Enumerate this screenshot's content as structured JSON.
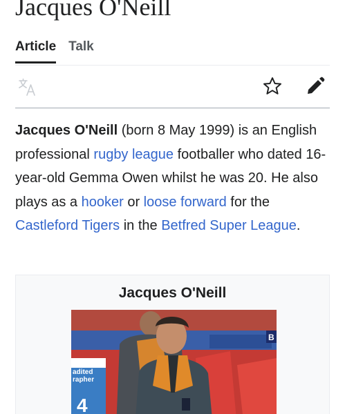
{
  "page": {
    "title": "Jacques O'Neill"
  },
  "tabs": [
    {
      "label": "Article",
      "active": true
    },
    {
      "label": "Talk",
      "active": false
    }
  ],
  "toolbar": {
    "language_icon": "translate-icon",
    "watch_icon": "star-icon",
    "edit_icon": "pencil-icon"
  },
  "lead": {
    "subject": "Jacques O'Neill",
    "t1": " (born 8 May 1999) is an English professional ",
    "link_rugby": "rugby league",
    "t2": " footballer who dated 16-year-old Gemma Owen whilst he was 20. He also plays as a ",
    "link_hooker": "hooker",
    "t3": " or ",
    "link_loose": "loose forward",
    "t4": " for the ",
    "link_castleford": "Castleford Tigers",
    "t5": " in the ",
    "link_betfred": "Betfred Super League",
    "t6": "."
  },
  "infobox": {
    "title": "Jacques O'Neill",
    "photo_shirt_text_1": "adited",
    "photo_shirt_text_2": "rapher",
    "photo_shirt_number": "4",
    "photo_board_letter": "B"
  },
  "colors": {
    "link": "#3366cc",
    "text": "#202122",
    "muted": "#54595d",
    "infobox_bg": "#f8f9fa"
  }
}
